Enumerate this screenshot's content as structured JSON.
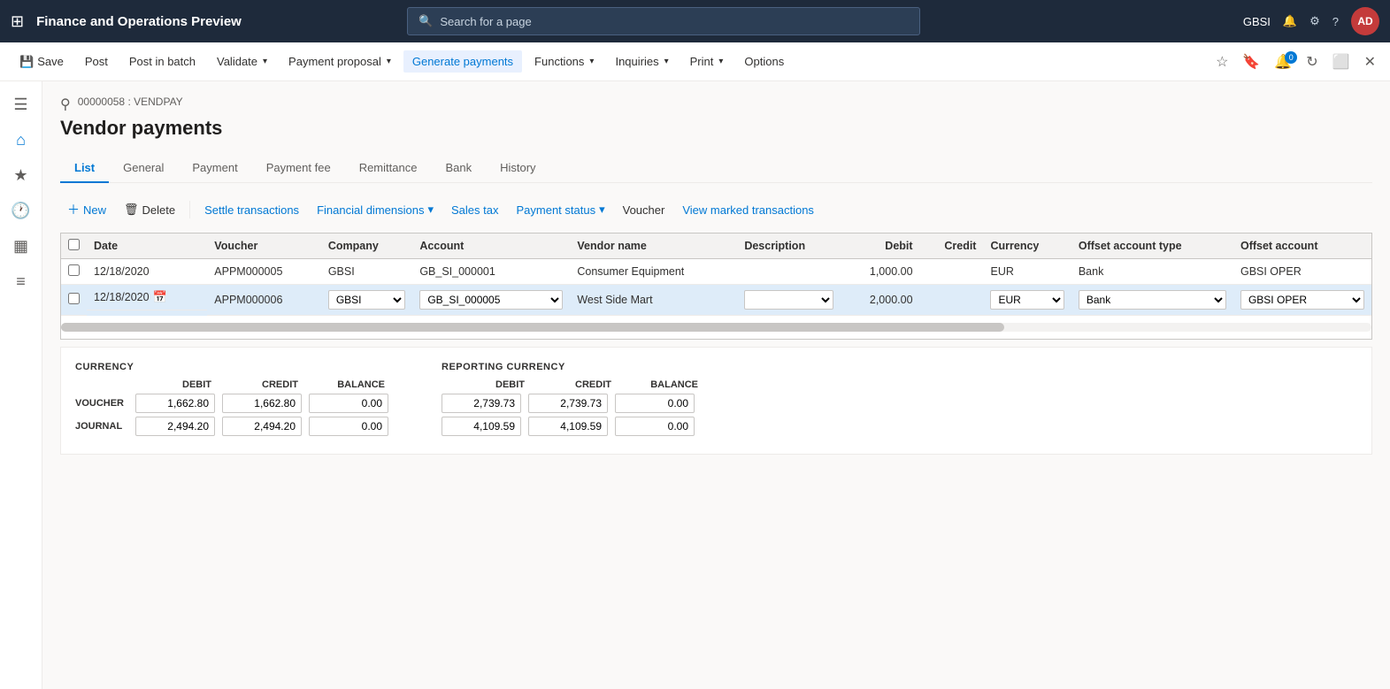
{
  "topNav": {
    "appTitle": "Finance and Operations Preview",
    "searchPlaceholder": "Search for a page",
    "userInitials": "AD",
    "gbsiLabel": "GBSI"
  },
  "actionBar": {
    "saveLabel": "Save",
    "postLabel": "Post",
    "postInBatchLabel": "Post in batch",
    "validateLabel": "Validate",
    "paymentProposalLabel": "Payment proposal",
    "generatePaymentsLabel": "Generate payments",
    "functionsLabel": "Functions",
    "inquiriesLabel": "Inquiries",
    "printLabel": "Print",
    "optionsLabel": "Options"
  },
  "breadcrumb": "00000058 : VENDPAY",
  "pageTitle": "Vendor payments",
  "tabs": [
    {
      "label": "List",
      "active": true
    },
    {
      "label": "General",
      "active": false
    },
    {
      "label": "Payment",
      "active": false
    },
    {
      "label": "Payment fee",
      "active": false
    },
    {
      "label": "Remittance",
      "active": false
    },
    {
      "label": "Bank",
      "active": false
    },
    {
      "label": "History",
      "active": false
    }
  ],
  "subToolbar": {
    "newLabel": "New",
    "deleteLabel": "Delete",
    "settleLabel": "Settle transactions",
    "financialDimLabel": "Financial dimensions",
    "salesTaxLabel": "Sales tax",
    "paymentStatusLabel": "Payment status",
    "voucherLabel": "Voucher",
    "viewMarkedLabel": "View marked transactions"
  },
  "table": {
    "columns": [
      {
        "id": "check",
        "label": ""
      },
      {
        "id": "date",
        "label": "Date"
      },
      {
        "id": "voucher",
        "label": "Voucher"
      },
      {
        "id": "company",
        "label": "Company"
      },
      {
        "id": "account",
        "label": "Account"
      },
      {
        "id": "vendorName",
        "label": "Vendor name"
      },
      {
        "id": "description",
        "label": "Description"
      },
      {
        "id": "debit",
        "label": "Debit",
        "align": "right"
      },
      {
        "id": "credit",
        "label": "Credit",
        "align": "right"
      },
      {
        "id": "currency",
        "label": "Currency"
      },
      {
        "id": "offsetAccountType",
        "label": "Offset account type"
      },
      {
        "id": "offsetAccount",
        "label": "Offset account"
      }
    ],
    "rows": [
      {
        "selected": false,
        "date": "12/18/2020",
        "voucher": "APPM000005",
        "company": "GBSI",
        "account": "GB_SI_000001",
        "vendorName": "Consumer Equipment",
        "description": "",
        "debit": "1,000.00",
        "credit": "",
        "currency": "EUR",
        "offsetAccountType": "Bank",
        "offsetAccount": "GBSI OPER",
        "editing": false
      },
      {
        "selected": true,
        "date": "12/18/2020",
        "voucher": "APPM000006",
        "company": "GBSI",
        "account": "GB_SI_000005",
        "vendorName": "West Side Mart",
        "description": "",
        "debit": "2,000.00",
        "credit": "",
        "currency": "EUR",
        "offsetAccountType": "Bank",
        "offsetAccount": "GBSI OPER",
        "editing": true
      }
    ]
  },
  "summary": {
    "currencyTitle": "CURRENCY",
    "reportingTitle": "REPORTING CURRENCY",
    "headers": [
      "DEBIT",
      "CREDIT",
      "BALANCE"
    ],
    "rowLabels": [
      "VOUCHER",
      "JOURNAL"
    ],
    "currency": {
      "voucher": {
        "debit": "1,662.80",
        "credit": "1,662.80",
        "balance": "0.00"
      },
      "journal": {
        "debit": "2,494.20",
        "credit": "2,494.20",
        "balance": "0.00"
      }
    },
    "reporting": {
      "voucher": {
        "debit": "2,739.73",
        "credit": "2,739.73",
        "balance": "0.00"
      },
      "journal": {
        "debit": "4,109.59",
        "credit": "4,109.59",
        "balance": "0.00"
      }
    }
  }
}
